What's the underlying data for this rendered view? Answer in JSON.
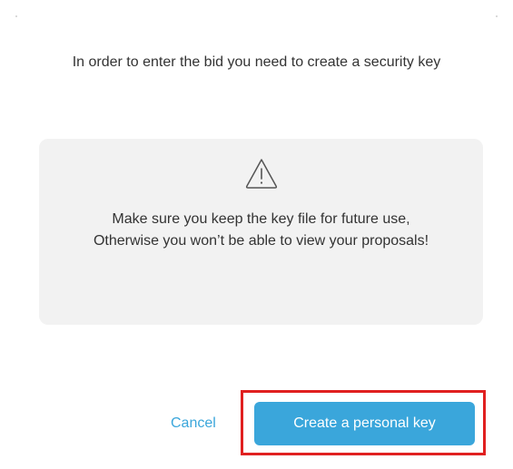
{
  "dialog": {
    "intro_text": "In order to enter the bid you need to create a security key",
    "warning": {
      "icon": "warning-triangle-icon",
      "message": "Make sure you keep the key file for future use,\nOtherwise you won’t be able to view your proposals!"
    },
    "actions": {
      "cancel_label": "Cancel",
      "primary_label": "Create a personal key"
    }
  },
  "colors": {
    "accent": "#3aa6db",
    "highlight": "#e02020",
    "panel_bg": "#f2f2f2",
    "text": "#333333"
  }
}
